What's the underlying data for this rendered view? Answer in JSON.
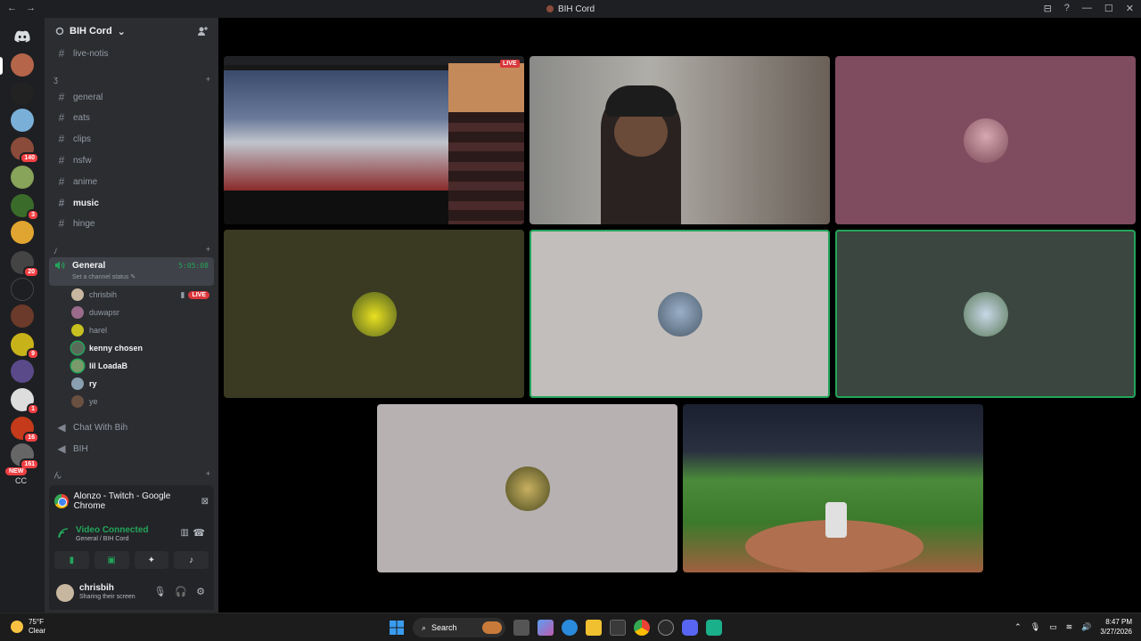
{
  "window": {
    "title": "BIH Cord",
    "back": "←",
    "forward": "→",
    "controls": [
      "⊟",
      "?",
      "—",
      "☐",
      "✕"
    ]
  },
  "guild_badges": [
    "140",
    "3",
    "20",
    "9",
    "1",
    "16",
    "161"
  ],
  "guild_new_label": "NEW",
  "guild_cc_label": "CC",
  "server": {
    "name": "BIH Cord",
    "chevron": "⌄"
  },
  "channels": {
    "top": [
      {
        "label": "live-notis"
      }
    ],
    "category1": {
      "label": "ʒ",
      "plus": "+"
    },
    "list": [
      {
        "label": "general"
      },
      {
        "label": "eats"
      },
      {
        "label": "clips"
      },
      {
        "label": "nsfw"
      },
      {
        "label": "anime"
      },
      {
        "label": "music"
      },
      {
        "label": "hinge"
      }
    ],
    "category2": {
      "label": "ﾉ",
      "plus": "+"
    },
    "voice": {
      "label": "General",
      "timer": "5:05:08",
      "status": "Set a channel status"
    },
    "voice_users": [
      {
        "name": "chrisbih",
        "live": "LIVE"
      },
      {
        "name": "duwapsr"
      },
      {
        "name": "harel"
      },
      {
        "name": "kenny chosen"
      },
      {
        "name": "lil LoadaB"
      },
      {
        "name": "ry"
      },
      {
        "name": "ye"
      }
    ],
    "other_voice": [
      {
        "label": "Chat With Bih"
      },
      {
        "label": "BIH"
      }
    ],
    "category3": {
      "label": "ん",
      "plus": "+"
    }
  },
  "panel": {
    "share_title": "Alonzo - Twitch - Google Chrome",
    "vc_status": "Video Connected",
    "vc_channel": "General / BIH Cord",
    "user": {
      "name": "chrisbih",
      "status": "Sharing their screen"
    }
  },
  "taskbar": {
    "temp": "75°F",
    "condition": "Clear",
    "search_label": "Search",
    "time": "8:47 PM",
    "date": "3/27/2026"
  },
  "colors": {
    "tile_pink": "#7f4b5f",
    "tile_olive": "#3a3a22",
    "tile_gray": "#c2bebb",
    "tile_slate": "#3a463f",
    "tile_rose": "#b8b1b2",
    "green": "#23a55a",
    "red": "#da373c"
  }
}
